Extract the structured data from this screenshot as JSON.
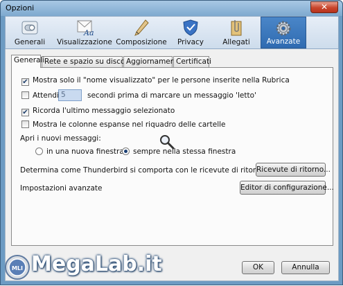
{
  "window": {
    "title": "Opzioni",
    "close_glyph": "✕"
  },
  "toolbar": {
    "buttons": [
      {
        "label": "Generali",
        "icon": "switch-icon"
      },
      {
        "label": "Visualizzazione",
        "icon": "font-letter-icon"
      },
      {
        "label": "Composizione",
        "icon": "pen-icon"
      },
      {
        "label": "Privacy",
        "icon": "shield-icon"
      },
      {
        "label": "Allegati",
        "icon": "paperclip-folder-icon"
      },
      {
        "label": "Avanzate",
        "icon": "gear-icon"
      }
    ],
    "active": "Avanzate"
  },
  "tabs": [
    "Generali",
    "Rete e spazio su disco",
    "Aggiornamenti",
    "Certificati"
  ],
  "active_tab": "Generali",
  "general": {
    "show_display_name": {
      "label": "Mostra solo il \"nome visualizzato\" per le persone inserite nella Rubrica",
      "checked": true
    },
    "wait_before_read": {
      "label_before": "Attendi",
      "value": "5",
      "label_after": "secondi prima di marcare un messaggio 'letto'",
      "checked": false
    },
    "remember_last": {
      "label": "Ricorda l'ultimo messaggio selezionato",
      "checked": true
    },
    "expanded_columns": {
      "label": "Mostra le colonne espanse nel riquadro delle cartelle",
      "checked": false
    },
    "open_messages_label": "Apri i nuovi messaggi:",
    "open_new_window": {
      "label": "in una nuova finestra",
      "selected": false
    },
    "open_same_window": {
      "label": "sempre nella stessa finestra",
      "selected": true
    },
    "receipts_text": "Determina come Thunderbird si comporta con le ricevute di ritorno",
    "receipts_button": "Ricevute di ritorno...",
    "advanced_text": "Impostazioni avanzate",
    "config_button": "Editor di configurazione..."
  },
  "footer": {
    "ok": "OK",
    "cancel": "Annulla"
  },
  "watermark": {
    "text": "MegaLab.it",
    "logo_initials": "MLI"
  },
  "colors": {
    "active_tab_blue": "#2f6bb1",
    "window_blue": "#6c9bc3"
  }
}
